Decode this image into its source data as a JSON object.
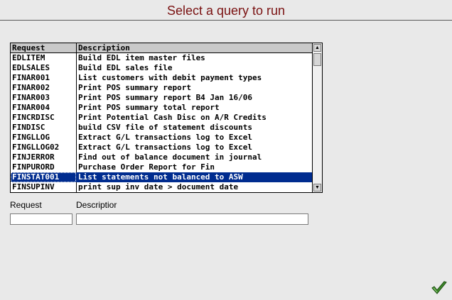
{
  "page": {
    "title": "Select a query to run"
  },
  "grid": {
    "columns": [
      "Request",
      "Description"
    ],
    "rows": [
      {
        "request": "EDLITEM",
        "description": "Build EDL item master files"
      },
      {
        "request": "EDLSALES",
        "description": "Build EDL sales file"
      },
      {
        "request": "FINAR001",
        "description": "List customers with debit payment types"
      },
      {
        "request": "FINAR002",
        "description": "Print POS summary report"
      },
      {
        "request": "FINAR003",
        "description": "Print POS summary report B4 Jan 16/06"
      },
      {
        "request": "FINAR004",
        "description": "Print POS summary total report"
      },
      {
        "request": "FINCRDISC",
        "description": "Print Potential Cash Disc on A/R Credits"
      },
      {
        "request": "FINDISC",
        "description": "build CSV file of statement discounts"
      },
      {
        "request": "FINGLLOG",
        "description": "Extract G/L transactions log to Excel"
      },
      {
        "request": "FINGLLOG02",
        "description": "Extract G/L transactions log to Excel"
      },
      {
        "request": "FINJERROR",
        "description": "Find out of balance document in journal"
      },
      {
        "request": "FINPURORD",
        "description": "Purchase Order Report for Fin"
      },
      {
        "request": "FINSTAT001",
        "description": "List statements not balanced to ASW",
        "selected": true
      },
      {
        "request": "FINSUPINV",
        "description": "print sup inv date > document date"
      }
    ]
  },
  "form": {
    "request_label": "Request",
    "description_label": "Descriptior",
    "request_value": "",
    "description_value": ""
  },
  "icons": {
    "ok": "checkmark-icon",
    "scroll_up": "arrow-up-icon",
    "scroll_down": "arrow-down-icon"
  },
  "colors": {
    "title": "#7a1212",
    "selection": "#002c8f",
    "ok_icon": "#3f8a2a"
  }
}
